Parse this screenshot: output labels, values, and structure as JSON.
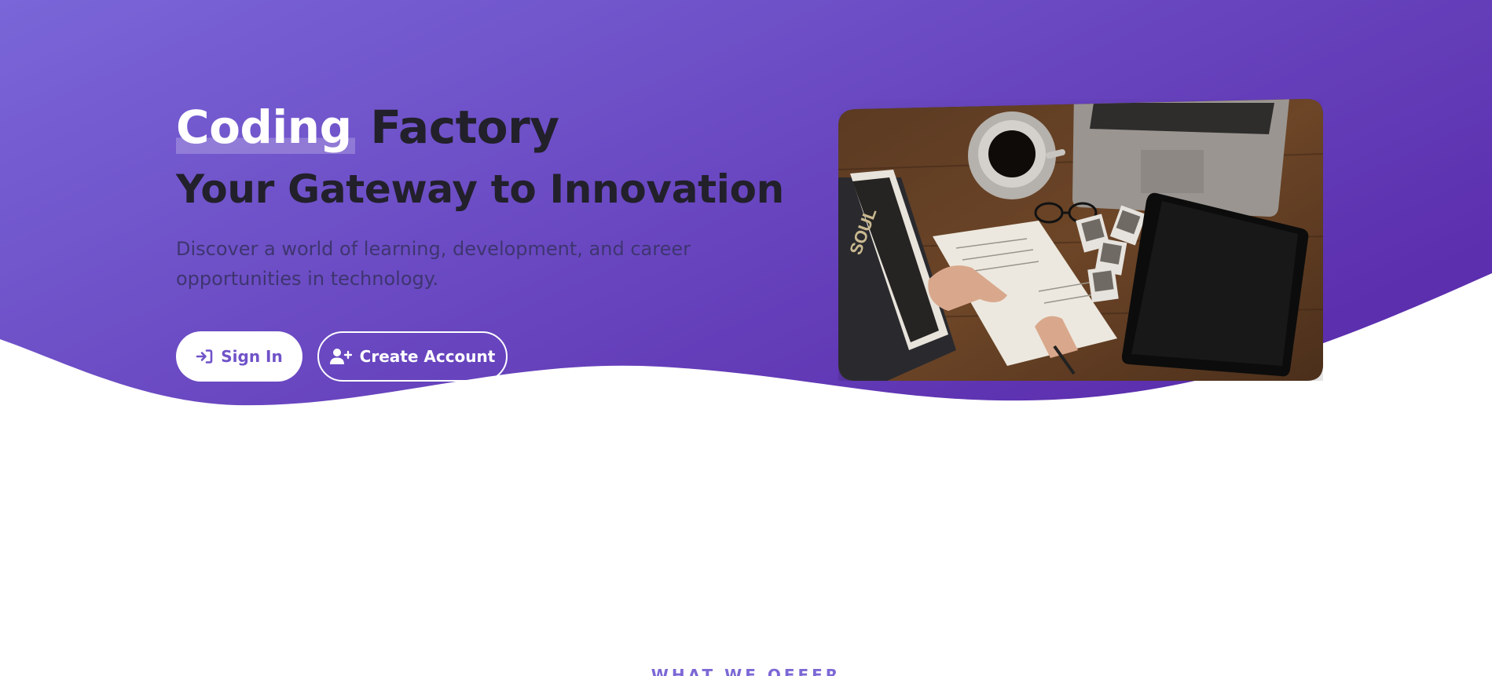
{
  "hero": {
    "title_highlight": "Coding",
    "title_rest": "Factory",
    "tagline": "Your Gateway to Innovation",
    "description": "Discover a world of learning, development, and career opportunities in technology.",
    "buttons": {
      "sign_in": {
        "label": "Sign In",
        "icon": "sign-in-icon"
      },
      "create_account": {
        "label": "Create Account",
        "icon": "user-plus-icon"
      }
    },
    "image": {
      "subject": "workspace-desk-photo",
      "book_title": "SOUL"
    }
  },
  "section": {
    "label": "WHAT WE OFFER"
  },
  "colors": {
    "gradient_start": "#7a66d8",
    "gradient_end": "#5c2fae",
    "heading_dark": "#22202b",
    "button_accent": "#6f52c9",
    "section_label": "#7d68d5"
  }
}
